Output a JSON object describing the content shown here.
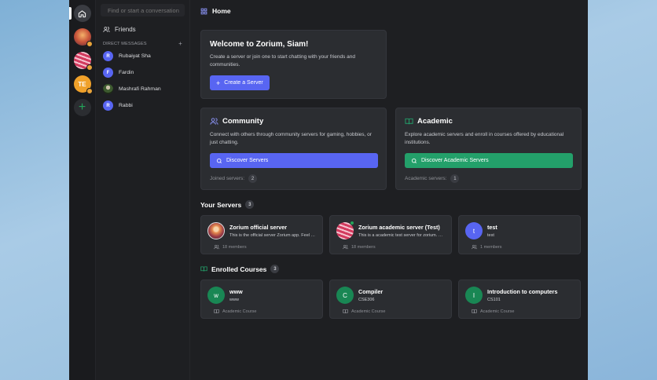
{
  "search": {
    "placeholder": "Find or start a conversation"
  },
  "rail": {
    "server3_initials": "TE",
    "add_symbol": "+"
  },
  "sidebar": {
    "friends_label": "Friends",
    "dm_header": "DIRECT MESSAGES",
    "dm_add": "+",
    "dms": [
      {
        "initial": "R",
        "name": "Rubaiyat Sha"
      },
      {
        "initial": "F",
        "name": "Fardin"
      },
      {
        "initial": "",
        "name": "Mashrafi Rahman"
      },
      {
        "initial": "R",
        "name": "Rabbi"
      }
    ]
  },
  "header": {
    "title": "Home"
  },
  "welcome": {
    "title": "Welcome to Zorium, Siam!",
    "text": "Create a server or join one to start chatting with your friends and communities.",
    "button": "Create a Server"
  },
  "community": {
    "title": "Community",
    "text": "Connect with others through community servers for gaming, hobbies, or just chatting.",
    "button": "Discover Servers",
    "joined_label": "Joined servers:",
    "joined_count": "2"
  },
  "academic": {
    "title": "Academic",
    "text": "Explore academic servers and enroll in courses offered by educational institutions.",
    "button": "Discover Academic Servers",
    "count_label": "Academic servers:",
    "count": "1"
  },
  "servers": {
    "title": "Your Servers",
    "count": "3",
    "items": [
      {
        "initial": "",
        "name": "Zorium official server",
        "desc": "This is the official server Zorium app. Feel free to join",
        "members": "18 members"
      },
      {
        "initial": "",
        "name": "Zorium academic server (Test)",
        "desc": "This is a academic test server for zorium. Welcome",
        "members": "18 members"
      },
      {
        "initial": "t",
        "name": "test",
        "desc": "test",
        "members": "1 members"
      }
    ]
  },
  "courses": {
    "title": "Enrolled Courses",
    "count": "3",
    "items": [
      {
        "initial": "w",
        "name": "www",
        "code": "www",
        "type": "Academic Course"
      },
      {
        "initial": "C",
        "name": "Compiler",
        "code": "CSE306",
        "type": "Academic Course"
      },
      {
        "initial": "I",
        "name": "Introduction to computers",
        "code": "CS101",
        "type": "Academic Course"
      }
    ]
  },
  "colors": {
    "accent": "#5865f2",
    "green": "#23a06a",
    "background": "#1e1f22",
    "card": "#2b2d31"
  }
}
